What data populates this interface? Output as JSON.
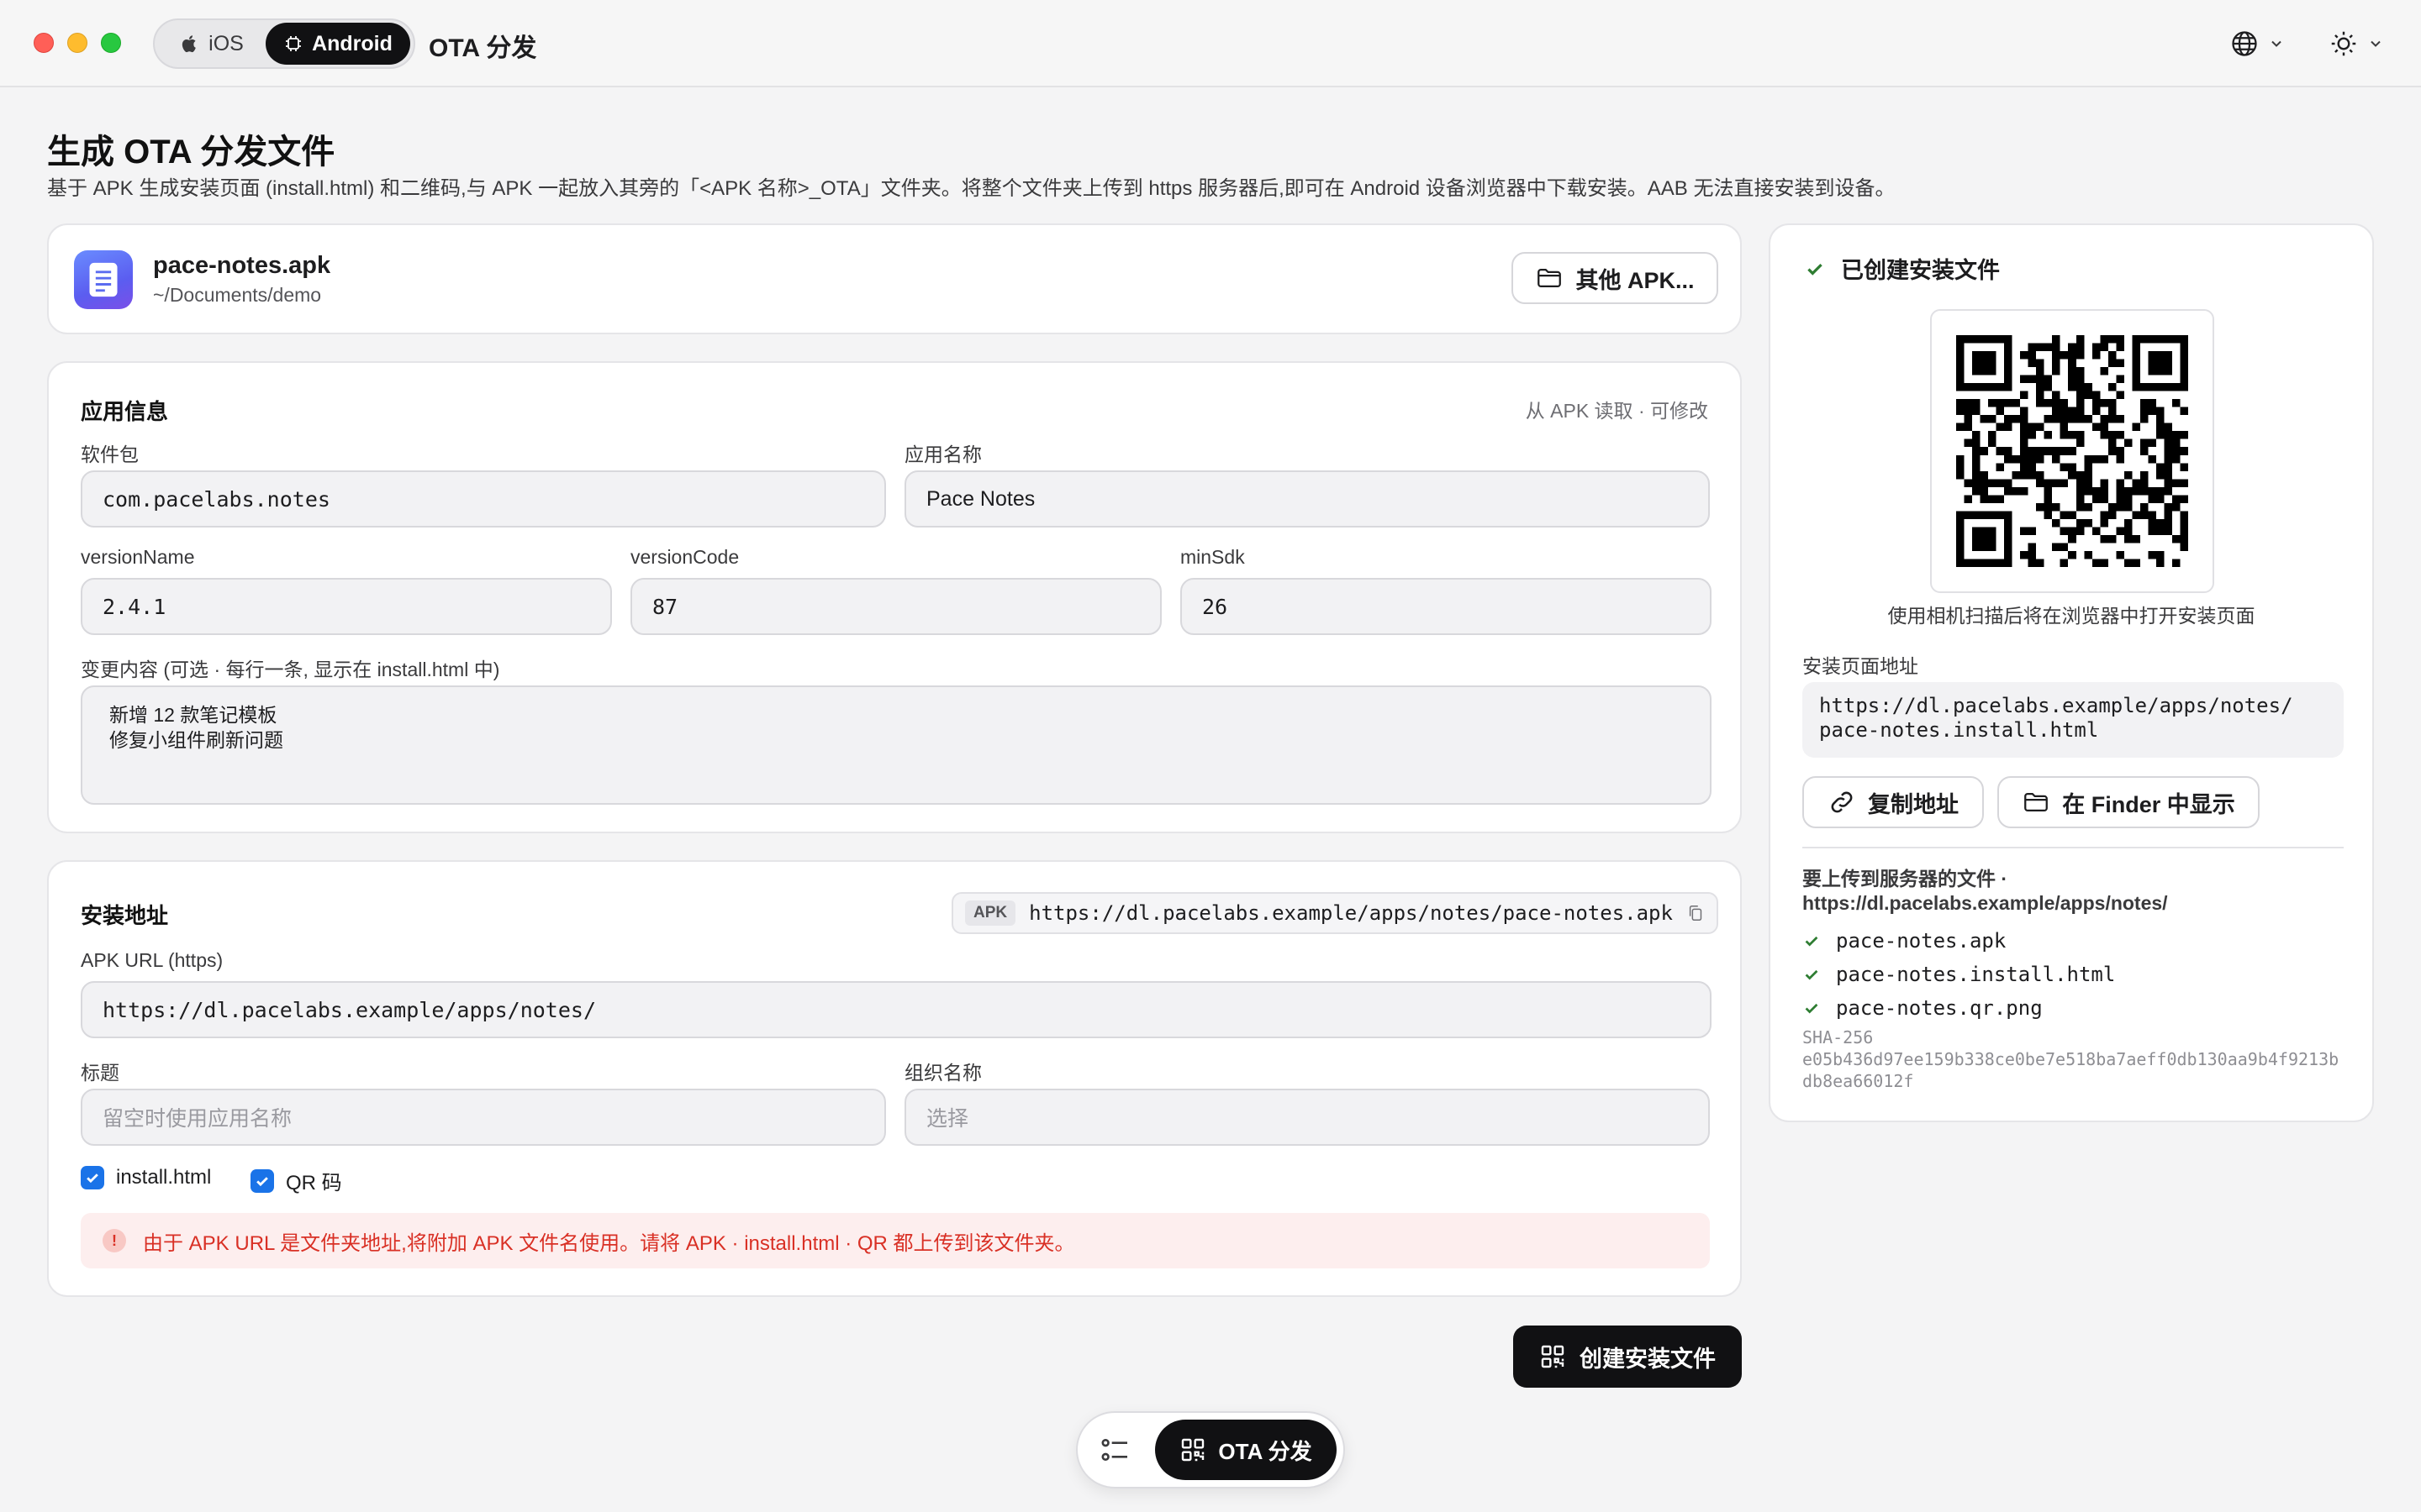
{
  "titlebar": {
    "tabs": [
      {
        "label": "iOS",
        "selected": false
      },
      {
        "label": "Android",
        "selected": true
      }
    ],
    "app_title": "OTA 分发",
    "language_icon": "globe-icon",
    "theme_icon": "sun-icon"
  },
  "page": {
    "title": "生成 OTA 分发文件",
    "description": "基于 APK 生成安装页面 (install.html) 和二维码,与 APK 一起放入其旁的「<APK 名称>_OTA」文件夹。将整个文件夹上传到 https 服务器后,即可在 Android 设备浏览器中下载安装。AAB 无法直接安装到设备。"
  },
  "file": {
    "name": "pace-notes.apk",
    "path": "~/Documents/demo",
    "other_button": "其他 APK..."
  },
  "app_info": {
    "title": "应用信息",
    "hint": "从 APK 读取 · 可修改",
    "package_label": "软件包",
    "package_value": "com.pacelabs.notes",
    "app_name_label": "应用名称",
    "app_name_value": "Pace Notes",
    "version_name_label": "versionName",
    "version_name_value": "2.4.1",
    "version_code_label": "versionCode",
    "version_code_value": "87",
    "min_sdk_label": "minSdk",
    "min_sdk_value": "26",
    "changes_label": "变更内容 (可选 · 每行一条, 显示在 install.html 中)",
    "changes_lines": [
      "新增 12 款笔记模板",
      "修复小组件刷新问题"
    ]
  },
  "install_address": {
    "title": "安装地址",
    "apk_tag": "APK",
    "apk_full_url": "https://dl.pacelabs.example/apps/notes/pace-notes.apk",
    "apk_url_label": "APK URL (https)",
    "apk_url_value": "https://dl.pacelabs.example/apps/notes/",
    "title_label": "标题",
    "title_placeholder": "留空时使用应用名称",
    "org_label": "组织名称",
    "org_placeholder": "选择",
    "option_install_html": "install.html",
    "option_qr": "QR 码",
    "option_install_html_checked": true,
    "option_qr_checked": true,
    "warning": "由于 APK URL 是文件夹地址,将附加 APK 文件名使用。请将 APK · install.html · QR 都上传到该文件夹。"
  },
  "create_button": "创建安装文件",
  "result": {
    "title": "已创建安装文件",
    "qr_caption": "使用相机扫描后将在浏览器中打开安装页面",
    "install_url_label": "安装页面地址",
    "install_url_line1": "https://dl.pacelabs.example/apps/notes/",
    "install_url_line2": "pace-notes.install.html",
    "copy_button": "复制地址",
    "finder_button": "在 Finder 中显示",
    "upload_title": "要上传到服务器的文件 · https://dl.pacelabs.example/apps/notes/",
    "files": [
      "pace-notes.apk",
      "pace-notes.install.html",
      "pace-notes.qr.png"
    ],
    "sha_label": "SHA-256",
    "sha_value": "e05b436d97ee159b338ce0be7e518ba7aeff0db130aa9b4f9213bdb8ea66012f"
  },
  "dock": {
    "list_icon": "checklist-icon",
    "ota_label": "OTA 分发"
  },
  "colors": {
    "accent": "#1a73e8",
    "dark_button": "#111113",
    "warning_text": "#d93025",
    "warning_bg": "#fdeeee",
    "success_check": "#2e7d32"
  }
}
